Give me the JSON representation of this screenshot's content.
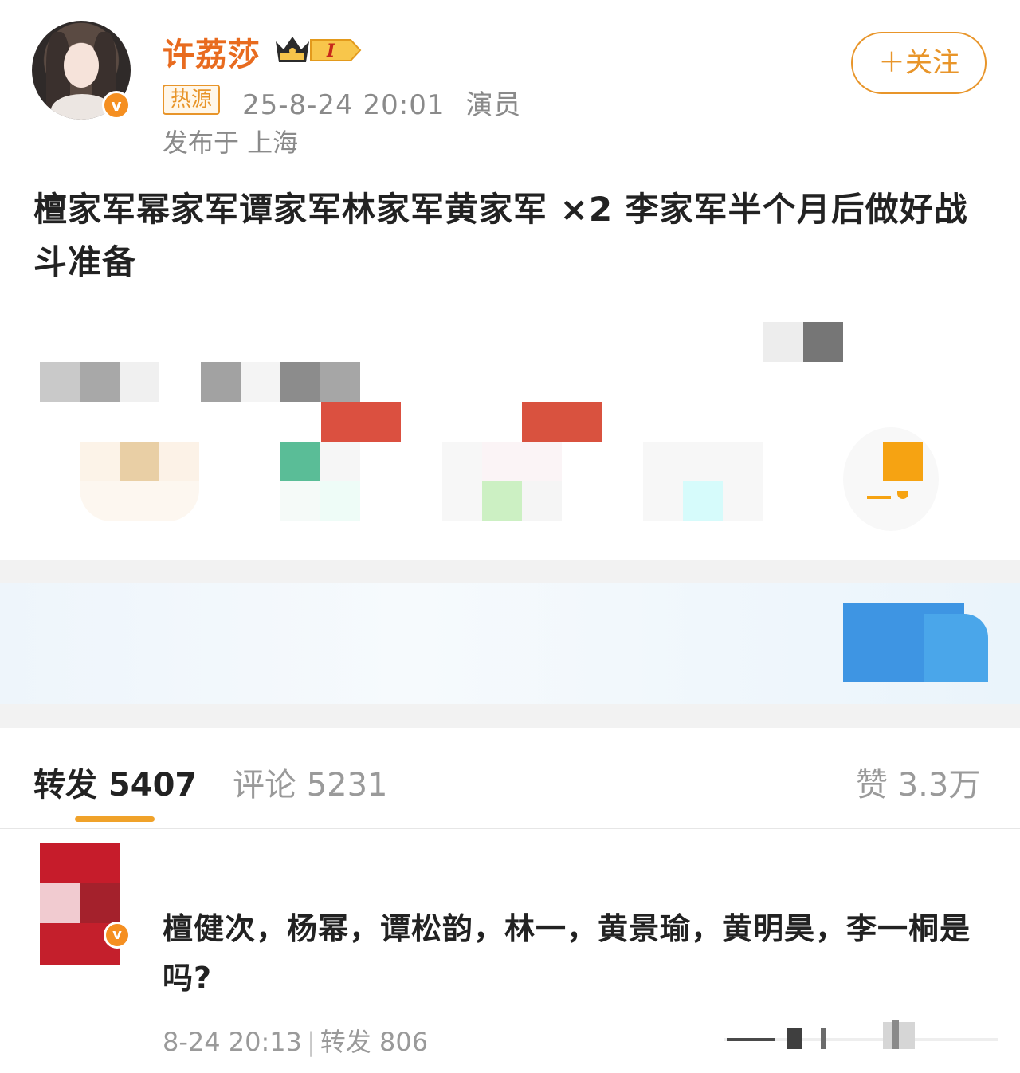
{
  "post": {
    "author": {
      "name": "许荔莎",
      "level": "I",
      "verified_mark": "v"
    },
    "tag": "热源",
    "datetime": "25-8-24 20:01",
    "role": "演员",
    "location": "发布于 上海",
    "follow_label": "＋关注",
    "text": "檀家军幂家军谭家军林家军黄家军 ×2 李家军半个月后做好战斗准备"
  },
  "tabs": {
    "repost": "转发 5407",
    "comment": "评论 5231",
    "like": "赞 3.3万"
  },
  "repost_item": {
    "verified_mark": "v",
    "text": "檀健次，杨幂，谭松韵，林一，黄景瑜，黄明昊，李一桐是吗?",
    "time": "8-24 20:13",
    "repost_count": "转发 806"
  },
  "colors": {
    "accent_orange": "#e86b1f",
    "follow_orange": "#e8952a",
    "card_blue": "#3e95e3"
  }
}
